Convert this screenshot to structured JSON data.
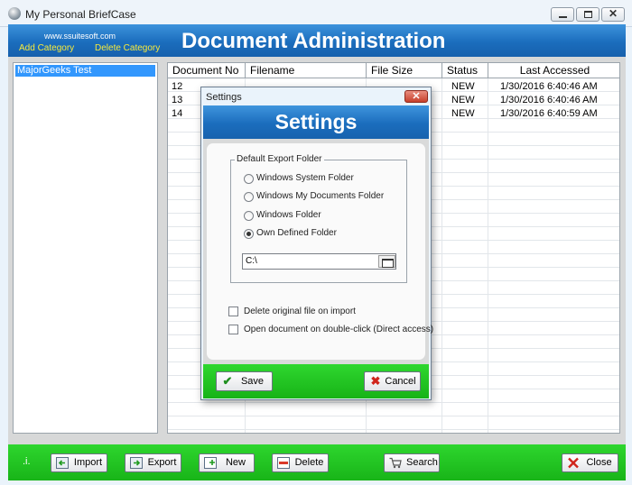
{
  "window": {
    "title": "My Personal BriefCase"
  },
  "header": {
    "site": "www.ssuitesoft.com",
    "add_category": "Add Category",
    "delete_category": "Delete Category",
    "title": "Document Administration"
  },
  "categories": {
    "selected": "MajorGeeks Test"
  },
  "table": {
    "columns": [
      "Document No",
      "Filename",
      "File Size",
      "Status",
      "Last Accessed"
    ],
    "rows": [
      {
        "doc_no": "12",
        "status": "NEW",
        "accessed": "1/30/2016 6:40:46 AM"
      },
      {
        "doc_no": "13",
        "status": "NEW",
        "accessed": "1/30/2016 6:40:46 AM"
      },
      {
        "doc_no": "14",
        "status": "NEW",
        "accessed": "1/30/2016 6:40:59 AM"
      }
    ]
  },
  "footer": {
    "indicator": ".i.",
    "import": "Import",
    "export": "Export",
    "new": "New",
    "delete": "Delete",
    "search": "Search",
    "close": "Close"
  },
  "dialog": {
    "title": "Settings",
    "heading": "Settings",
    "group_label": "Default Export Folder",
    "options": [
      {
        "label": "Windows System Folder",
        "checked": false
      },
      {
        "label": "Windows My Documents Folder",
        "checked": false
      },
      {
        "label": "Windows Folder",
        "checked": false
      },
      {
        "label": "Own Defined Folder",
        "checked": true
      }
    ],
    "folder_value": "C:\\",
    "delete_on_import": "Delete original file on import",
    "open_on_double_click": "Open document on double-click (Direct access)",
    "save": "Save",
    "cancel": "Cancel"
  },
  "colors": {
    "header_blue": "#1b6dbd",
    "footer_green": "#18b418",
    "accent_yellow": "#f7ea3c",
    "selection_blue": "#3297fd"
  }
}
